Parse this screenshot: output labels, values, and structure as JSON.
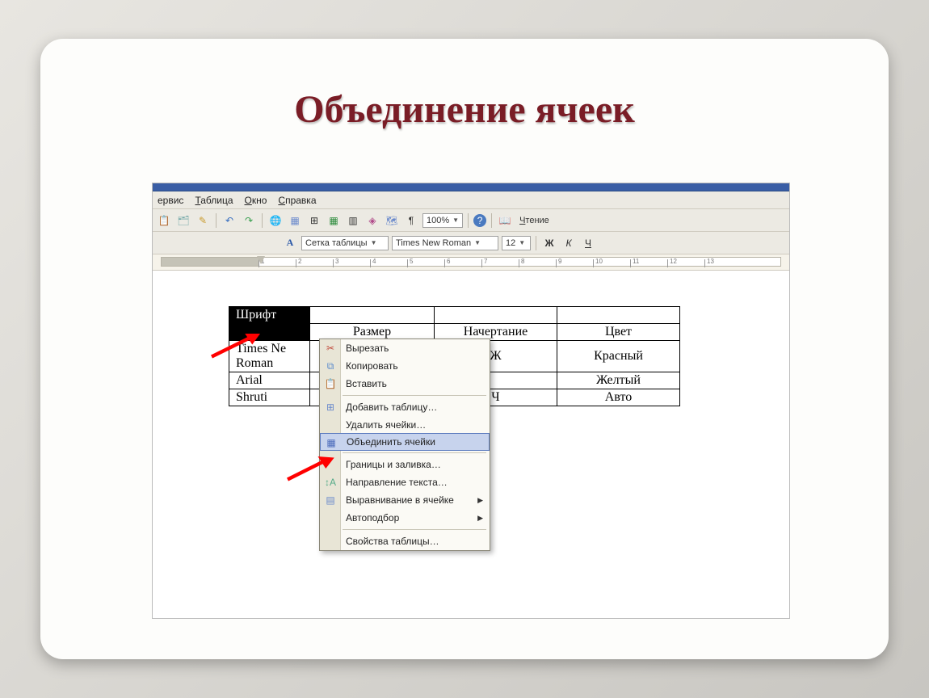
{
  "slide": {
    "title": "Объединение ячеек"
  },
  "menus": {
    "service": "ервис",
    "table": "Таблица",
    "window": "Окно",
    "help": "Справка"
  },
  "toolbar1": {
    "zoom": "100%",
    "reading": "Чтение"
  },
  "toolbar2": {
    "style_icon": "A",
    "style": "Сетка таблицы",
    "font": "Times New Roman",
    "size": "12",
    "bold": "Ж",
    "italic": "К",
    "underline": "Ч"
  },
  "ruler_numbers": [
    "1",
    "2",
    "3",
    "4",
    "5",
    "6",
    "7",
    "8",
    "9",
    "10",
    "11",
    "12",
    "13"
  ],
  "table": {
    "r1c1": "Шрифт",
    "r2c2": "Размер",
    "r2c3": "Начертание",
    "r2c4": "Цвет",
    "r3c1a": "Times Ne",
    "r3c1b": "Roman",
    "r3c3": "Ж",
    "r3c4": "Красный",
    "r4c1": "Arial",
    "r4c4": "Желтый",
    "r5c1": "Shruti",
    "r5c3": "Ч",
    "r5c4": "Авто"
  },
  "context_menu": {
    "cut": "Вырезать",
    "copy": "Копировать",
    "paste": "Вставить",
    "insert_table": "Добавить таблицу…",
    "delete_cells": "Удалить ячейки…",
    "merge_cells": "Объединить ячейки",
    "borders_shading": "Границы и заливка…",
    "text_direction": "Направление текста…",
    "cell_alignment": "Выравнивание в ячейке",
    "autofit": "Автоподбор",
    "table_props": "Свойства таблицы…"
  }
}
